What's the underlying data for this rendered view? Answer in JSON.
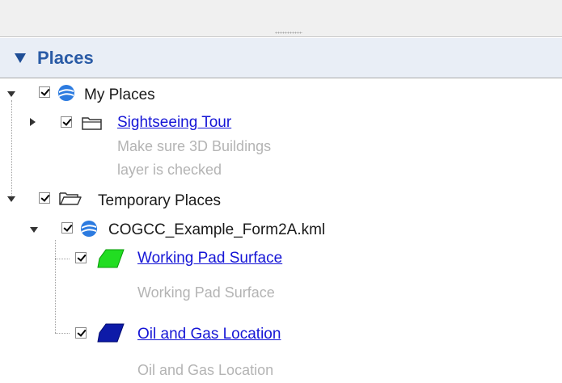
{
  "panel": {
    "title": "Places"
  },
  "tree": {
    "my_places": {
      "label": "My Places"
    },
    "sightseeing_tour": {
      "label": "Sightseeing Tour",
      "description_line1": "Make sure 3D Buildings",
      "description_line2": "layer is checked"
    },
    "temporary_places": {
      "label": "Temporary Places"
    },
    "kml_file": {
      "label": "COGCC_Example_Form2A.kml"
    },
    "working_pad": {
      "label": "Working Pad Surface",
      "description": "Working Pad Surface",
      "color": "#22dd22"
    },
    "oil_gas": {
      "label": "Oil and Gas Location",
      "description": "Oil and Gas Location",
      "color": "#0d1aa8"
    }
  }
}
